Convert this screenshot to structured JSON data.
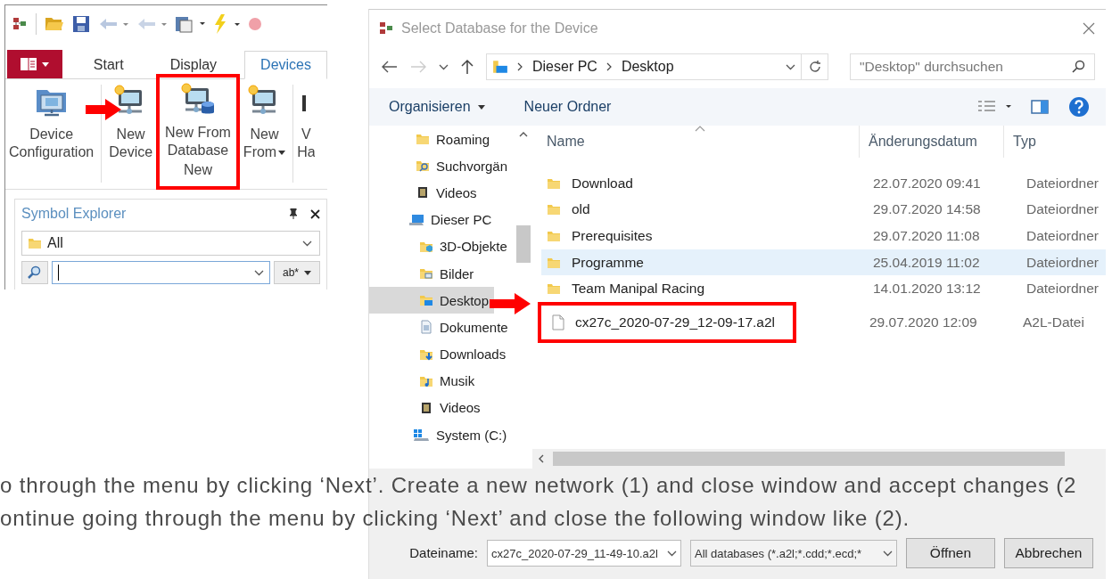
{
  "ribbon_window": {
    "tabs": [
      {
        "label": "Start",
        "selected": false
      },
      {
        "label": "Display",
        "selected": false
      },
      {
        "label": "Devices",
        "selected": true
      }
    ],
    "ribbon_buttons": [
      {
        "lines": [
          "Device",
          "Configuration"
        ],
        "kind": "config",
        "dropdown": false,
        "highlighted": false
      },
      {
        "lines": [
          "New",
          "Device"
        ],
        "kind": "new",
        "dropdown": false,
        "highlighted": false
      },
      {
        "lines": [
          "New From",
          "Database"
        ],
        "kind": "database",
        "dropdown": false,
        "highlighted": true
      },
      {
        "lines": [
          "New",
          "From"
        ],
        "kind": "new",
        "dropdown": true,
        "highlighted": false
      },
      {
        "lines": [
          "V",
          "Ha"
        ],
        "kind": "partial",
        "dropdown": false,
        "highlighted": false
      }
    ],
    "group_label": "New",
    "symbol_explorer": {
      "title": "Symbol Explorer",
      "filter": "All",
      "search_option": "ab*"
    }
  },
  "file_dialog": {
    "title": "Select Database for the Device",
    "breadcrumb": [
      "Dieser PC",
      "Desktop"
    ],
    "search_placeholder": "\"Desktop\" durchsuchen",
    "toolbar": [
      {
        "label": "Organisieren",
        "dropdown": true
      },
      {
        "label": "Neuer Ordner",
        "dropdown": false
      }
    ],
    "nav_items": [
      {
        "label": "Roaming",
        "kind": "folder",
        "selected": false
      },
      {
        "label": "Suchvorgän",
        "kind": "search",
        "selected": false
      },
      {
        "label": "Videos",
        "kind": "video",
        "selected": false
      },
      {
        "label": "Dieser PC",
        "kind": "pc",
        "selected": false,
        "children": [
          {
            "label": "3D-Objekte",
            "kind": "objects",
            "selected": false
          },
          {
            "label": "Bilder",
            "kind": "pictures",
            "selected": false
          },
          {
            "label": "Desktop",
            "kind": "desktop",
            "selected": true
          },
          {
            "label": "Dokumente",
            "kind": "documents",
            "selected": false
          },
          {
            "label": "Downloads",
            "kind": "downloads",
            "selected": false
          },
          {
            "label": "Musik",
            "kind": "music",
            "selected": false
          },
          {
            "label": "Videos",
            "kind": "video",
            "selected": false
          },
          {
            "label": "System (C:)",
            "kind": "drive",
            "selected": false
          }
        ]
      }
    ],
    "columns": [
      "Name",
      "Änderungsdatum",
      "Typ"
    ],
    "rows": [
      {
        "name": "Download",
        "date": "22.07.2020 09:41",
        "type": "Dateiordner",
        "kind": "folder",
        "selected": false,
        "highlighted": false
      },
      {
        "name": "old",
        "date": "29.07.2020 14:58",
        "type": "Dateiordner",
        "kind": "folder",
        "selected": false,
        "highlighted": false
      },
      {
        "name": "Prerequisites",
        "date": "29.07.2020 11:08",
        "type": "Dateiordner",
        "kind": "folder",
        "selected": false,
        "highlighted": false
      },
      {
        "name": "Programme",
        "date": "25.04.2019 11:02",
        "type": "Dateiordner",
        "kind": "folder",
        "selected": true,
        "highlighted": false
      },
      {
        "name": "Team Manipal Racing",
        "date": "14.01.2020 13:12",
        "type": "Dateiordner",
        "kind": "folder",
        "selected": false,
        "highlighted": false
      },
      {
        "name": "cx27c_2020-07-29_12-09-17.a2l",
        "date": "29.07.2020 12:09",
        "type": "A2L-Datei",
        "kind": "file",
        "selected": false,
        "highlighted": true
      }
    ],
    "filename_label": "Dateiname:",
    "filename_value": "cx27c_2020-07-29_11-49-10.a2l",
    "file_type": "All databases (*.a2l;*.cdd;*.ecd;*",
    "buttons": [
      "Öffnen",
      "Abbrechen"
    ]
  },
  "paragraph_lines": [
    "o through the menu by clicking ‘Next’. Create a new network (1) and close window and accept changes (2",
    "ontinue going through the menu by clicking ‘Next’ and close the following window like (2)."
  ]
}
